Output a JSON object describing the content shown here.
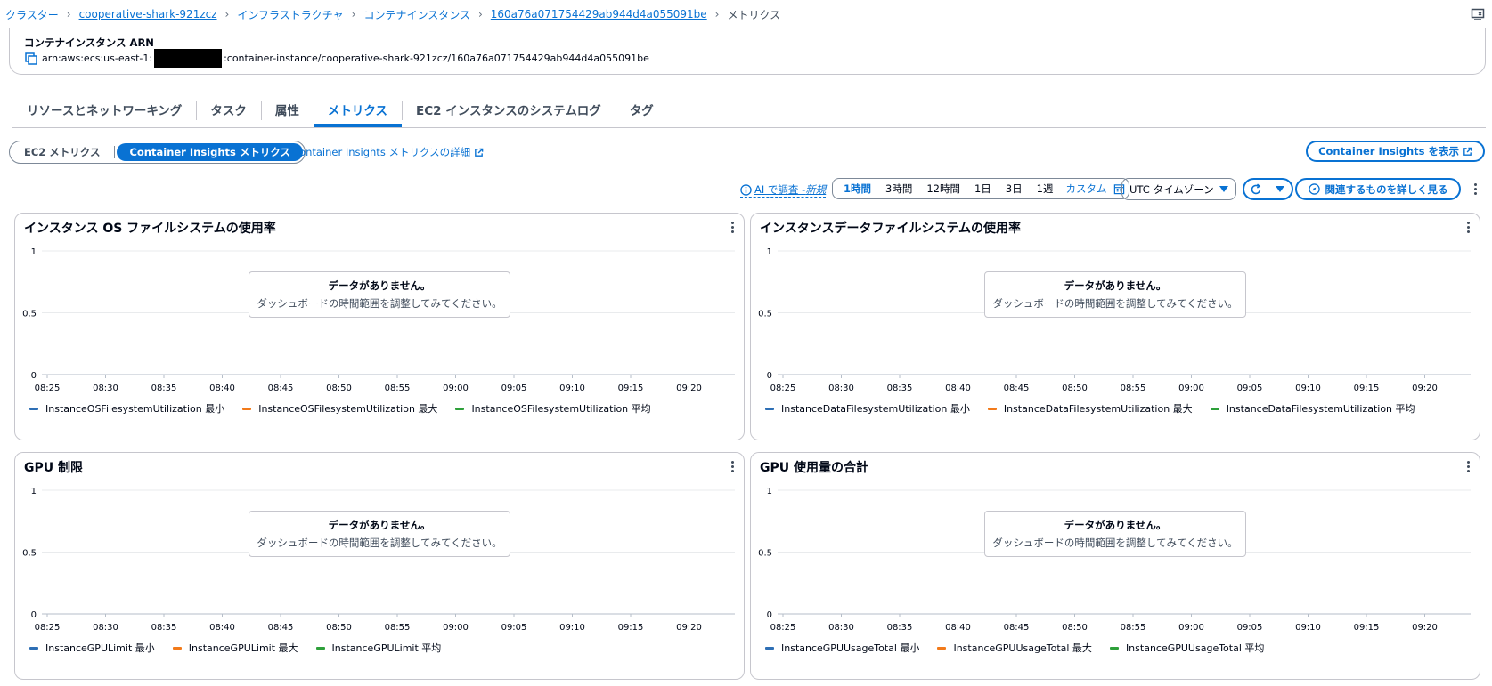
{
  "breadcrumb": {
    "items": [
      "クラスター",
      "cooperative-shark-921zcz",
      "インフラストラクチャ",
      "コンテナインスタンス",
      "160a76a071754429ab944d4a055091be"
    ],
    "current": "メトリクス"
  },
  "arn": {
    "label": "コンテナインスタンス ARN",
    "prefix": "arn:aws:ecs:us-east-1:",
    "suffix": ":container-instance/cooperative-shark-921zcz/160a76a071754429ab944d4a055091be"
  },
  "tabs": [
    "リソースとネットワーキング",
    "タスク",
    "属性",
    "メトリクス",
    "EC2 インスタンスのシステムログ",
    "タグ"
  ],
  "active_tab": "メトリクス",
  "segmented": {
    "options": [
      "EC2 メトリクス",
      "Container Insights メトリクス"
    ],
    "selected": "Container Insights メトリクス"
  },
  "details_link": "Container Insights メトリクスの詳細",
  "view_ci_button": "Container Insights を表示",
  "ai": {
    "label": "AI で調査 - ",
    "badge": "新規"
  },
  "time_range": {
    "options": [
      "1時間",
      "3時間",
      "12時間",
      "1日",
      "3日",
      "1週"
    ],
    "selected": "1時間",
    "custom": "カスタム"
  },
  "timezone": "UTC タイムゾーン",
  "explore_button": "関連するものを詳しく見る",
  "colors": {
    "accent": "#0972d3",
    "series_min": "#2e6fb5",
    "series_max": "#f27a1a",
    "series_avg": "#2ea03a"
  },
  "no_data": {
    "title": "データがありません。",
    "message": "ダッシュボードの時間範囲を調整してみてください。"
  },
  "chart_data": [
    {
      "type": "line",
      "title": "インスタンス OS ファイルシステムの使用率",
      "x": [
        "08:25",
        "08:30",
        "08:35",
        "08:40",
        "08:45",
        "08:50",
        "08:55",
        "09:00",
        "09:05",
        "09:10",
        "09:15",
        "09:20"
      ],
      "y_ticks": [
        "1",
        "0.5",
        "0"
      ],
      "ylim": [
        0,
        1
      ],
      "series": [
        {
          "name": "InstanceOSFilesystemUtilization 最小",
          "values": []
        },
        {
          "name": "InstanceOSFilesystemUtilization 最大",
          "values": []
        },
        {
          "name": "InstanceOSFilesystemUtilization 平均",
          "values": []
        }
      ]
    },
    {
      "type": "line",
      "title": "インスタンスデータファイルシステムの使用率",
      "x": [
        "08:25",
        "08:30",
        "08:35",
        "08:40",
        "08:45",
        "08:50",
        "08:55",
        "09:00",
        "09:05",
        "09:10",
        "09:15",
        "09:20"
      ],
      "y_ticks": [
        "1",
        "0.5",
        "0"
      ],
      "ylim": [
        0,
        1
      ],
      "series": [
        {
          "name": "InstanceDataFilesystemUtilization 最小",
          "values": []
        },
        {
          "name": "InstanceDataFilesystemUtilization 最大",
          "values": []
        },
        {
          "name": "InstanceDataFilesystemUtilization 平均",
          "values": []
        }
      ]
    },
    {
      "type": "line",
      "title": "GPU 制限",
      "x": [
        "08:25",
        "08:30",
        "08:35",
        "08:40",
        "08:45",
        "08:50",
        "08:55",
        "09:00",
        "09:05",
        "09:10",
        "09:15",
        "09:20"
      ],
      "y_ticks": [
        "1",
        "0.5",
        "0"
      ],
      "ylim": [
        0,
        1
      ],
      "series": [
        {
          "name": "InstanceGPULimit 最小",
          "values": []
        },
        {
          "name": "InstanceGPULimit 最大",
          "values": []
        },
        {
          "name": "InstanceGPULimit 平均",
          "values": []
        }
      ]
    },
    {
      "type": "line",
      "title": "GPU 使用量の合計",
      "x": [
        "08:25",
        "08:30",
        "08:35",
        "08:40",
        "08:45",
        "08:50",
        "08:55",
        "09:00",
        "09:05",
        "09:10",
        "09:15",
        "09:20"
      ],
      "y_ticks": [
        "1",
        "0.5",
        "0"
      ],
      "ylim": [
        0,
        1
      ],
      "series": [
        {
          "name": "InstanceGPUUsageTotal 最小",
          "values": []
        },
        {
          "name": "InstanceGPUUsageTotal 最大",
          "values": []
        },
        {
          "name": "InstanceGPUUsageTotal 平均",
          "values": []
        }
      ]
    }
  ]
}
